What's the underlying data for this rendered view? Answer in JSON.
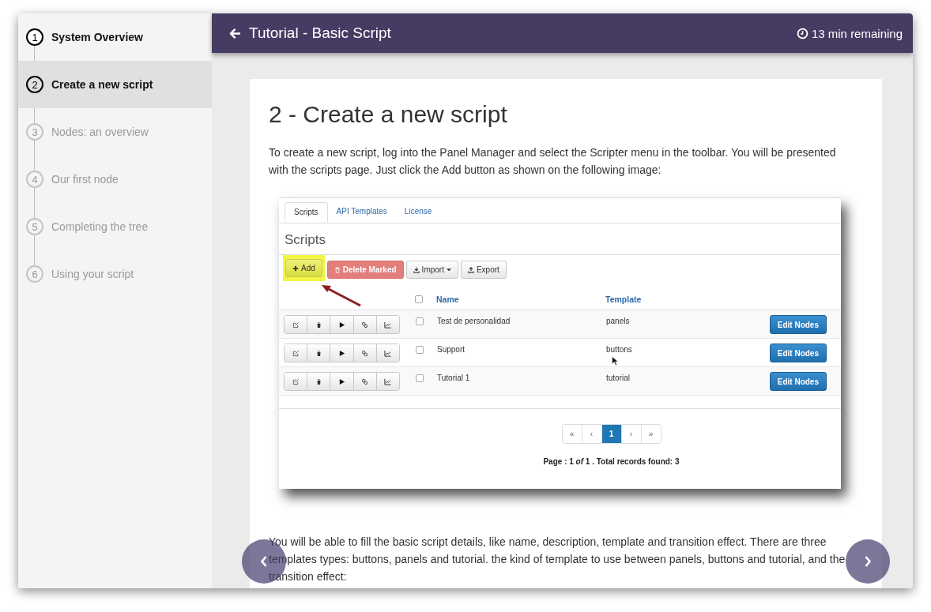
{
  "sidebar": {
    "steps": [
      {
        "number": "1",
        "label": "System Overview",
        "selected": false,
        "visited": true
      },
      {
        "number": "2",
        "label": "Create a new script",
        "selected": true,
        "visited": true
      },
      {
        "number": "3",
        "label": "Nodes: an overview",
        "selected": false,
        "visited": false
      },
      {
        "number": "4",
        "label": "Our first node",
        "selected": false,
        "visited": false
      },
      {
        "number": "5",
        "label": "Completing the tree",
        "selected": false,
        "visited": false
      },
      {
        "number": "6",
        "label": "Using your script",
        "selected": false,
        "visited": false
      }
    ]
  },
  "header": {
    "title": "Tutorial - Basic Script",
    "remaining": "13 min remaining"
  },
  "article": {
    "title": "2 - Create a new script",
    "intro": "To create a new script, log into the Panel Manager and select the Scripter menu in the toolbar. You will be presented with the scripts page. Just click the Add button as shown on the following image:",
    "screenshot": {
      "tabs": [
        {
          "label": "Scripts",
          "selected": true
        },
        {
          "label": "API Templates",
          "selected": false
        },
        {
          "label": "License",
          "selected": false
        }
      ],
      "heading": "Scripts",
      "toolbar": [
        {
          "label": "Add",
          "kind": "add",
          "highlighted": true
        },
        {
          "label": "Delete Marked",
          "kind": "delete",
          "highlighted": false
        },
        {
          "label": "Import",
          "kind": "import",
          "highlighted": false
        },
        {
          "label": "Export",
          "kind": "export",
          "highlighted": false
        }
      ],
      "select_all_checked": false,
      "columns": [
        "Name",
        "Template"
      ],
      "rows": [
        {
          "name": "Test de personalidad",
          "template": "panels",
          "checked": false,
          "action": "Edit Nodes"
        },
        {
          "name": "Support",
          "template": "buttons",
          "checked": false,
          "action": "Edit Nodes"
        },
        {
          "name": "Tutorial 1",
          "template": "tutorial",
          "checked": false,
          "action": "Edit Nodes"
        }
      ],
      "pagination": {
        "first": "«",
        "prev": "‹",
        "pages": [
          {
            "label": "1",
            "selected": true
          }
        ],
        "next": "›",
        "last": "»"
      },
      "summary": "Page : 1 *of* 1 . Total records found: 3"
    },
    "body": "You will be able to fill the basic script details, like name, description, template and transition effect. There are three templates types: buttons, panels and tutorial. the kind of template to use between panels, buttons and tutorial, and the transition effect:"
  }
}
